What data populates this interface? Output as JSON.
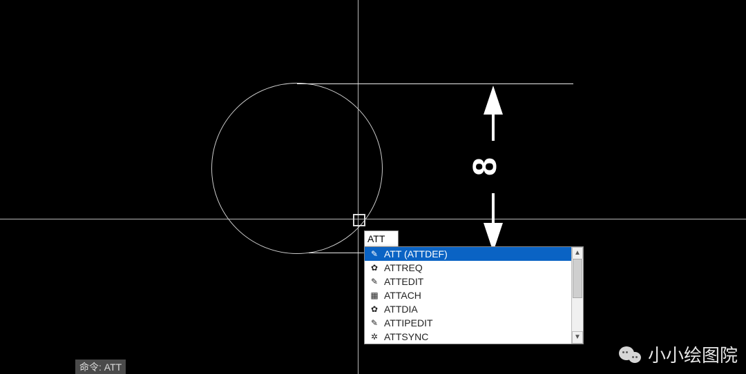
{
  "cursor": {
    "input_value": "ATT"
  },
  "suggestions": {
    "items": [
      {
        "label": "ATT (ATTDEF)",
        "icon": "✎",
        "selected": true
      },
      {
        "label": "ATTREQ",
        "icon": "✿",
        "selected": false
      },
      {
        "label": "ATTEDIT",
        "icon": "✎",
        "selected": false
      },
      {
        "label": "ATTACH",
        "icon": "▦",
        "selected": false
      },
      {
        "label": "ATTDIA",
        "icon": "✿",
        "selected": false
      },
      {
        "label": "ATTIPEDIT",
        "icon": "✎",
        "selected": false
      },
      {
        "label": "ATTSYNC",
        "icon": "✲",
        "selected": false
      }
    ]
  },
  "dimension": {
    "value": "8"
  },
  "commandline": {
    "prompt": "命令:",
    "text": "ATT"
  },
  "watermark": {
    "text": "小小绘图院"
  }
}
